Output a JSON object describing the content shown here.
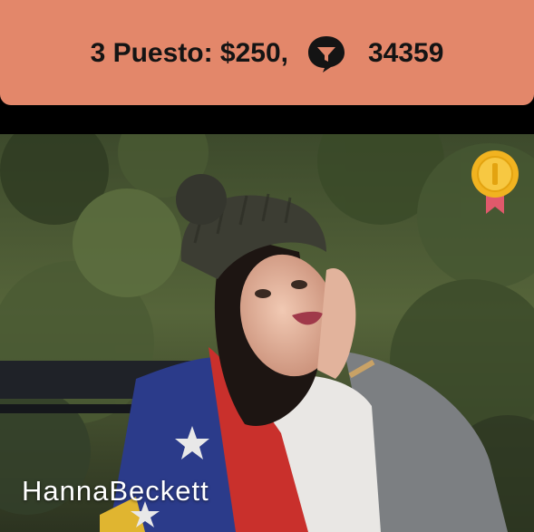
{
  "banner": {
    "prize_text": "3 Puesto: $250,",
    "votes": "34359",
    "vote_icon": "funnel-chat-icon",
    "background": "#E3876A"
  },
  "profile": {
    "username": "HannaBeckett",
    "photo_description_icon": "profile-photo",
    "badge_icon": "gold-medal-icon"
  }
}
